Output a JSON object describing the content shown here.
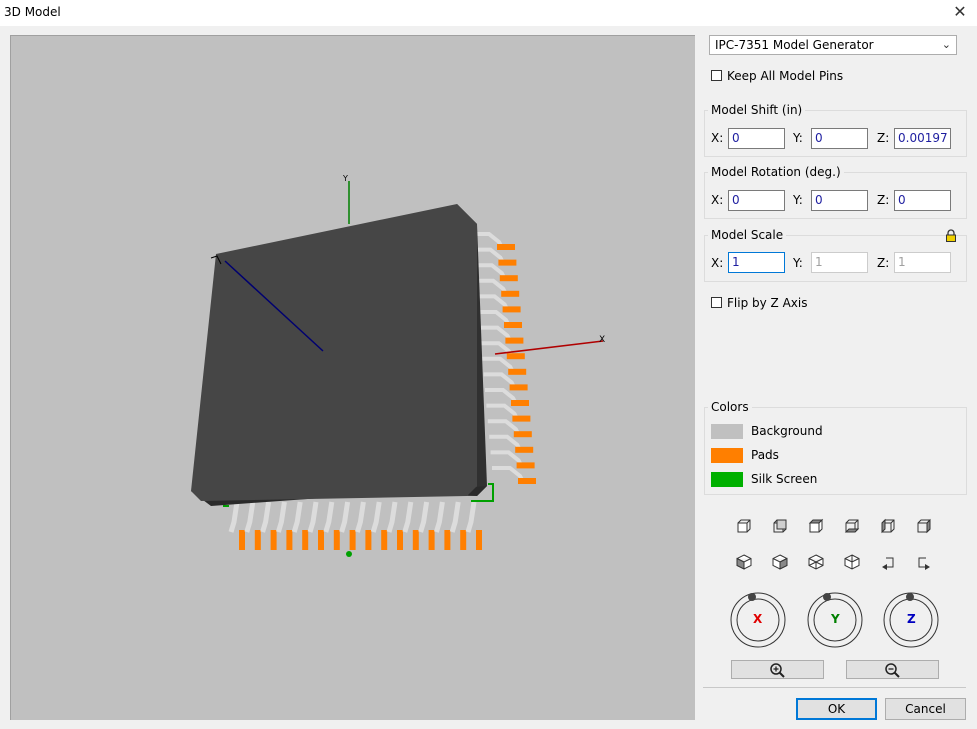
{
  "window": {
    "title": "3D Model",
    "close_glyph": "✕"
  },
  "viewport": {
    "background_color": "#c0c0c0",
    "axis_labels": {
      "x": "X",
      "y": "Y"
    }
  },
  "generator": {
    "selected": "IPC-7351 Model Generator"
  },
  "keep_all_pins": {
    "label": "Keep All Model Pins",
    "checked": false
  },
  "model_shift": {
    "title": "Model Shift (in)",
    "x_label": "X:",
    "x": "0",
    "y_label": "Y:",
    "y": "0",
    "z_label": "Z:",
    "z": "0.00197"
  },
  "model_rotation": {
    "title": "Model Rotation (deg.)",
    "x_label": "X:",
    "x": "0",
    "y_label": "Y:",
    "y": "0",
    "z_label": "Z:",
    "z": "0"
  },
  "model_scale": {
    "title": "Model Scale",
    "x_label": "X:",
    "x": "1",
    "y_label": "Y:",
    "y": "1",
    "z_label": "Z:",
    "z": "1",
    "lock_icon": "lock-icon"
  },
  "flip_z": {
    "label": "Flip by Z Axis",
    "checked": false
  },
  "colors": {
    "title": "Colors",
    "items": [
      {
        "label": "Background",
        "color": "#c0c0c0"
      },
      {
        "label": "Pads",
        "color": "#ff7f00"
      },
      {
        "label": "Silk Screen",
        "color": "#00b000"
      }
    ]
  },
  "rotate_controls": {
    "x": "X",
    "y": "Y",
    "z": "Z"
  },
  "buttons": {
    "ok": "OK",
    "cancel": "Cancel"
  }
}
